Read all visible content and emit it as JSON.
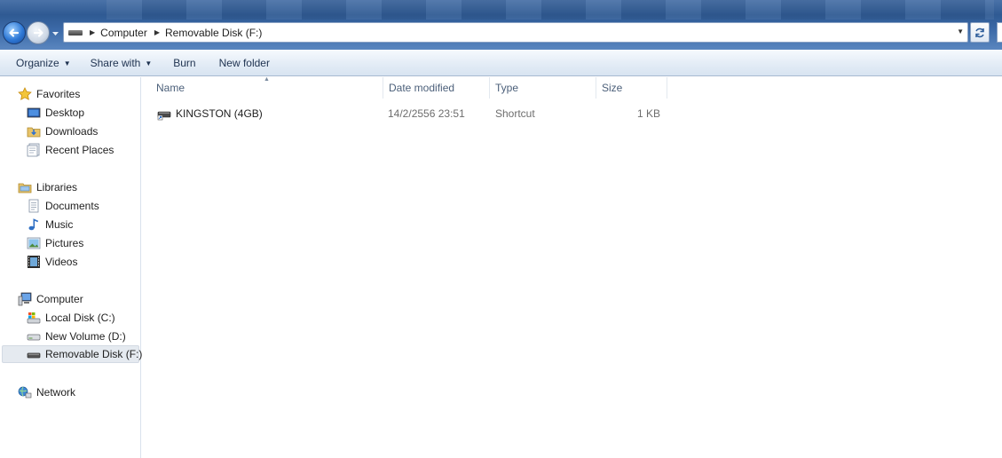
{
  "window": {
    "breadcrumb": [
      "Computer",
      "Removable Disk (F:)"
    ]
  },
  "toolbar": {
    "organize": "Organize",
    "share_with": "Share with",
    "burn": "Burn",
    "new_folder": "New folder"
  },
  "navigation": {
    "favorites": {
      "label": "Favorites",
      "items": [
        "Desktop",
        "Downloads",
        "Recent Places"
      ]
    },
    "libraries": {
      "label": "Libraries",
      "items": [
        "Documents",
        "Music",
        "Pictures",
        "Videos"
      ]
    },
    "computer": {
      "label": "Computer",
      "items": [
        "Local Disk (C:)",
        "New Volume (D:)",
        "Removable Disk (F:)"
      ],
      "selected": "Removable Disk (F:)"
    },
    "network": {
      "label": "Network"
    }
  },
  "columns": {
    "name": "Name",
    "date_modified": "Date modified",
    "type": "Type",
    "size": "Size"
  },
  "files": [
    {
      "name": "KINGSTON (4GB)",
      "date_modified": "14/2/2556 23:51",
      "type": "Shortcut",
      "size": "1 KB",
      "icon": "drive-shortcut-icon"
    }
  ],
  "colors": {
    "accent": "#2e78d6",
    "toolbar_text": "#1e3250",
    "header_text": "#4c607a"
  }
}
